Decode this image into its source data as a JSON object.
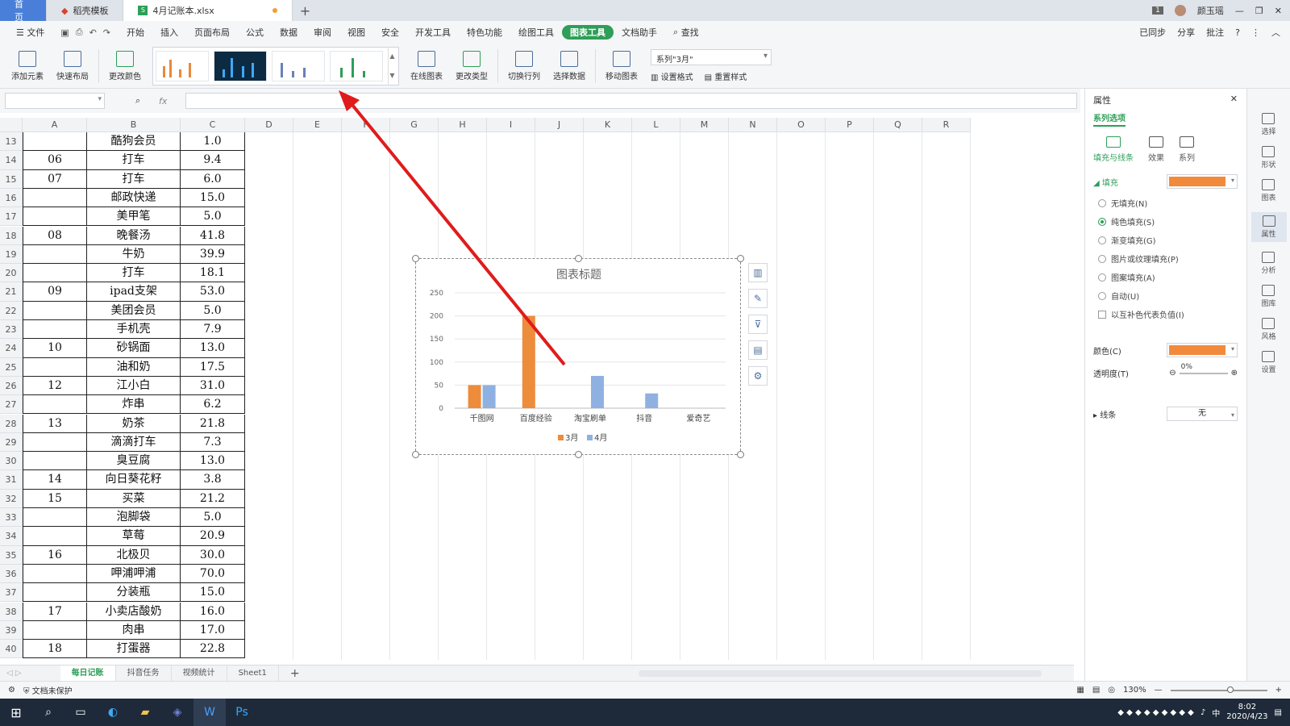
{
  "tabs": {
    "home": "首页",
    "template": "稻壳模板",
    "file": "4月记账本.xlsx"
  },
  "user": {
    "name": "颜玉瑶",
    "badge": "1"
  },
  "menu": [
    "文件",
    "开始",
    "插入",
    "页面布局",
    "公式",
    "数据",
    "审阅",
    "视图",
    "安全",
    "开发工具",
    "特色功能",
    "绘图工具",
    "图表工具",
    "文档助手",
    "查找"
  ],
  "menu_right": {
    "sync": "已同步",
    "share": "分享",
    "comment": "批注"
  },
  "ribbon": {
    "add_element": "添加元素",
    "quick_layout": "快速布局",
    "change_color": "更改颜色",
    "online_chart": "在线图表",
    "change_type": "更改类型",
    "switch_row_col": "切换行列",
    "select_data": "选择数据",
    "move_chart": "移动图表",
    "series_select": "系列\"3月\"",
    "set_format": "设置格式",
    "reset_style": "重置样式"
  },
  "formula": {
    "fx": "fx"
  },
  "columns": [
    "A",
    "B",
    "C",
    "D",
    "E",
    "F",
    "G",
    "H",
    "I",
    "J",
    "K",
    "L",
    "M",
    "N",
    "O",
    "P",
    "Q",
    "R"
  ],
  "rows": [
    {
      "n": "13",
      "a": "",
      "b": "酷狗会员",
      "c": "1.0"
    },
    {
      "n": "14",
      "a": "06",
      "b": "打车",
      "c": "9.4"
    },
    {
      "n": "15",
      "a": "07",
      "b": "打车",
      "c": "6.0"
    },
    {
      "n": "16",
      "a": "",
      "b": "邮政快递",
      "c": "15.0"
    },
    {
      "n": "17",
      "a": "",
      "b": "美甲笔",
      "c": "5.0"
    },
    {
      "n": "18",
      "a": "08",
      "b": "晚餐汤",
      "c": "41.8"
    },
    {
      "n": "19",
      "a": "",
      "b": "牛奶",
      "c": "39.9"
    },
    {
      "n": "20",
      "a": "",
      "b": "打车",
      "c": "18.1"
    },
    {
      "n": "21",
      "a": "09",
      "b": "ipad支架",
      "c": "53.0"
    },
    {
      "n": "22",
      "a": "",
      "b": "美团会员",
      "c": "5.0"
    },
    {
      "n": "23",
      "a": "",
      "b": "手机壳",
      "c": "7.9"
    },
    {
      "n": "24",
      "a": "10",
      "b": "砂锅面",
      "c": "13.0"
    },
    {
      "n": "25",
      "a": "",
      "b": "油和奶",
      "c": "17.5"
    },
    {
      "n": "26",
      "a": "12",
      "b": "江小白",
      "c": "31.0"
    },
    {
      "n": "27",
      "a": "",
      "b": "炸串",
      "c": "6.2"
    },
    {
      "n": "28",
      "a": "13",
      "b": "奶茶",
      "c": "21.8"
    },
    {
      "n": "29",
      "a": "",
      "b": "滴滴打车",
      "c": "7.3"
    },
    {
      "n": "30",
      "a": "",
      "b": "臭豆腐",
      "c": "13.0"
    },
    {
      "n": "31",
      "a": "14",
      "b": "向日葵花籽",
      "c": "3.8"
    },
    {
      "n": "32",
      "a": "15",
      "b": "买菜",
      "c": "21.2"
    },
    {
      "n": "33",
      "a": "",
      "b": "泡脚袋",
      "c": "5.0"
    },
    {
      "n": "34",
      "a": "",
      "b": "草莓",
      "c": "20.9"
    },
    {
      "n": "35",
      "a": "16",
      "b": "北极贝",
      "c": "30.0"
    },
    {
      "n": "36",
      "a": "",
      "b": "呷浦呷浦",
      "c": "70.0"
    },
    {
      "n": "37",
      "a": "",
      "b": "分装瓶",
      "c": "15.0"
    },
    {
      "n": "38",
      "a": "17",
      "b": "小卖店酸奶",
      "c": "16.0"
    },
    {
      "n": "39",
      "a": "",
      "b": "肉串",
      "c": "17.0"
    },
    {
      "n": "40",
      "a": "18",
      "b": "打蛋器",
      "c": "22.8"
    }
  ],
  "chart_data": {
    "type": "bar",
    "title": "图表标题",
    "categories": [
      "千图网",
      "百度经验",
      "淘宝刷单",
      "抖音",
      "爱奇艺"
    ],
    "series": [
      {
        "name": "3月",
        "color": "#ed8c3b",
        "values": [
          50,
          200,
          0,
          0,
          0
        ]
      },
      {
        "name": "4月",
        "color": "#8fb1e2",
        "values": [
          50,
          0,
          70,
          32,
          0
        ]
      }
    ],
    "ylim": [
      0,
      250
    ],
    "yticks": [
      0,
      50,
      100,
      150,
      200,
      250
    ],
    "legend": "bottom",
    "grid": true
  },
  "sheets": [
    "每日记账",
    "抖音任务",
    "视频统计",
    "Sheet1"
  ],
  "status": {
    "protect": "文档未保护",
    "zoom": "130%"
  },
  "panel": {
    "title": "属性",
    "sub": "系列选项",
    "tabs": [
      "填充与线条",
      "效果",
      "系列"
    ],
    "fill_label": "填充",
    "fill_color": "#f28a3c",
    "options": [
      "无填充(N)",
      "纯色填充(S)",
      "渐变填充(G)",
      "图片或纹理填充(P)",
      "图案填充(A)",
      "自动(U)"
    ],
    "invert": "以互补色代表负值(I)",
    "color_label": "颜色(C)",
    "transparency_label": "透明度(T)",
    "transparency": "0%",
    "line_label": "线条",
    "line_value": "无"
  },
  "sidebar": [
    "选择",
    "形状",
    "图表",
    "属性",
    "分析",
    "图库",
    "风格",
    "设置"
  ],
  "taskbar": {
    "time": "8:02",
    "date": "2020/4/23",
    "lang": "中"
  }
}
